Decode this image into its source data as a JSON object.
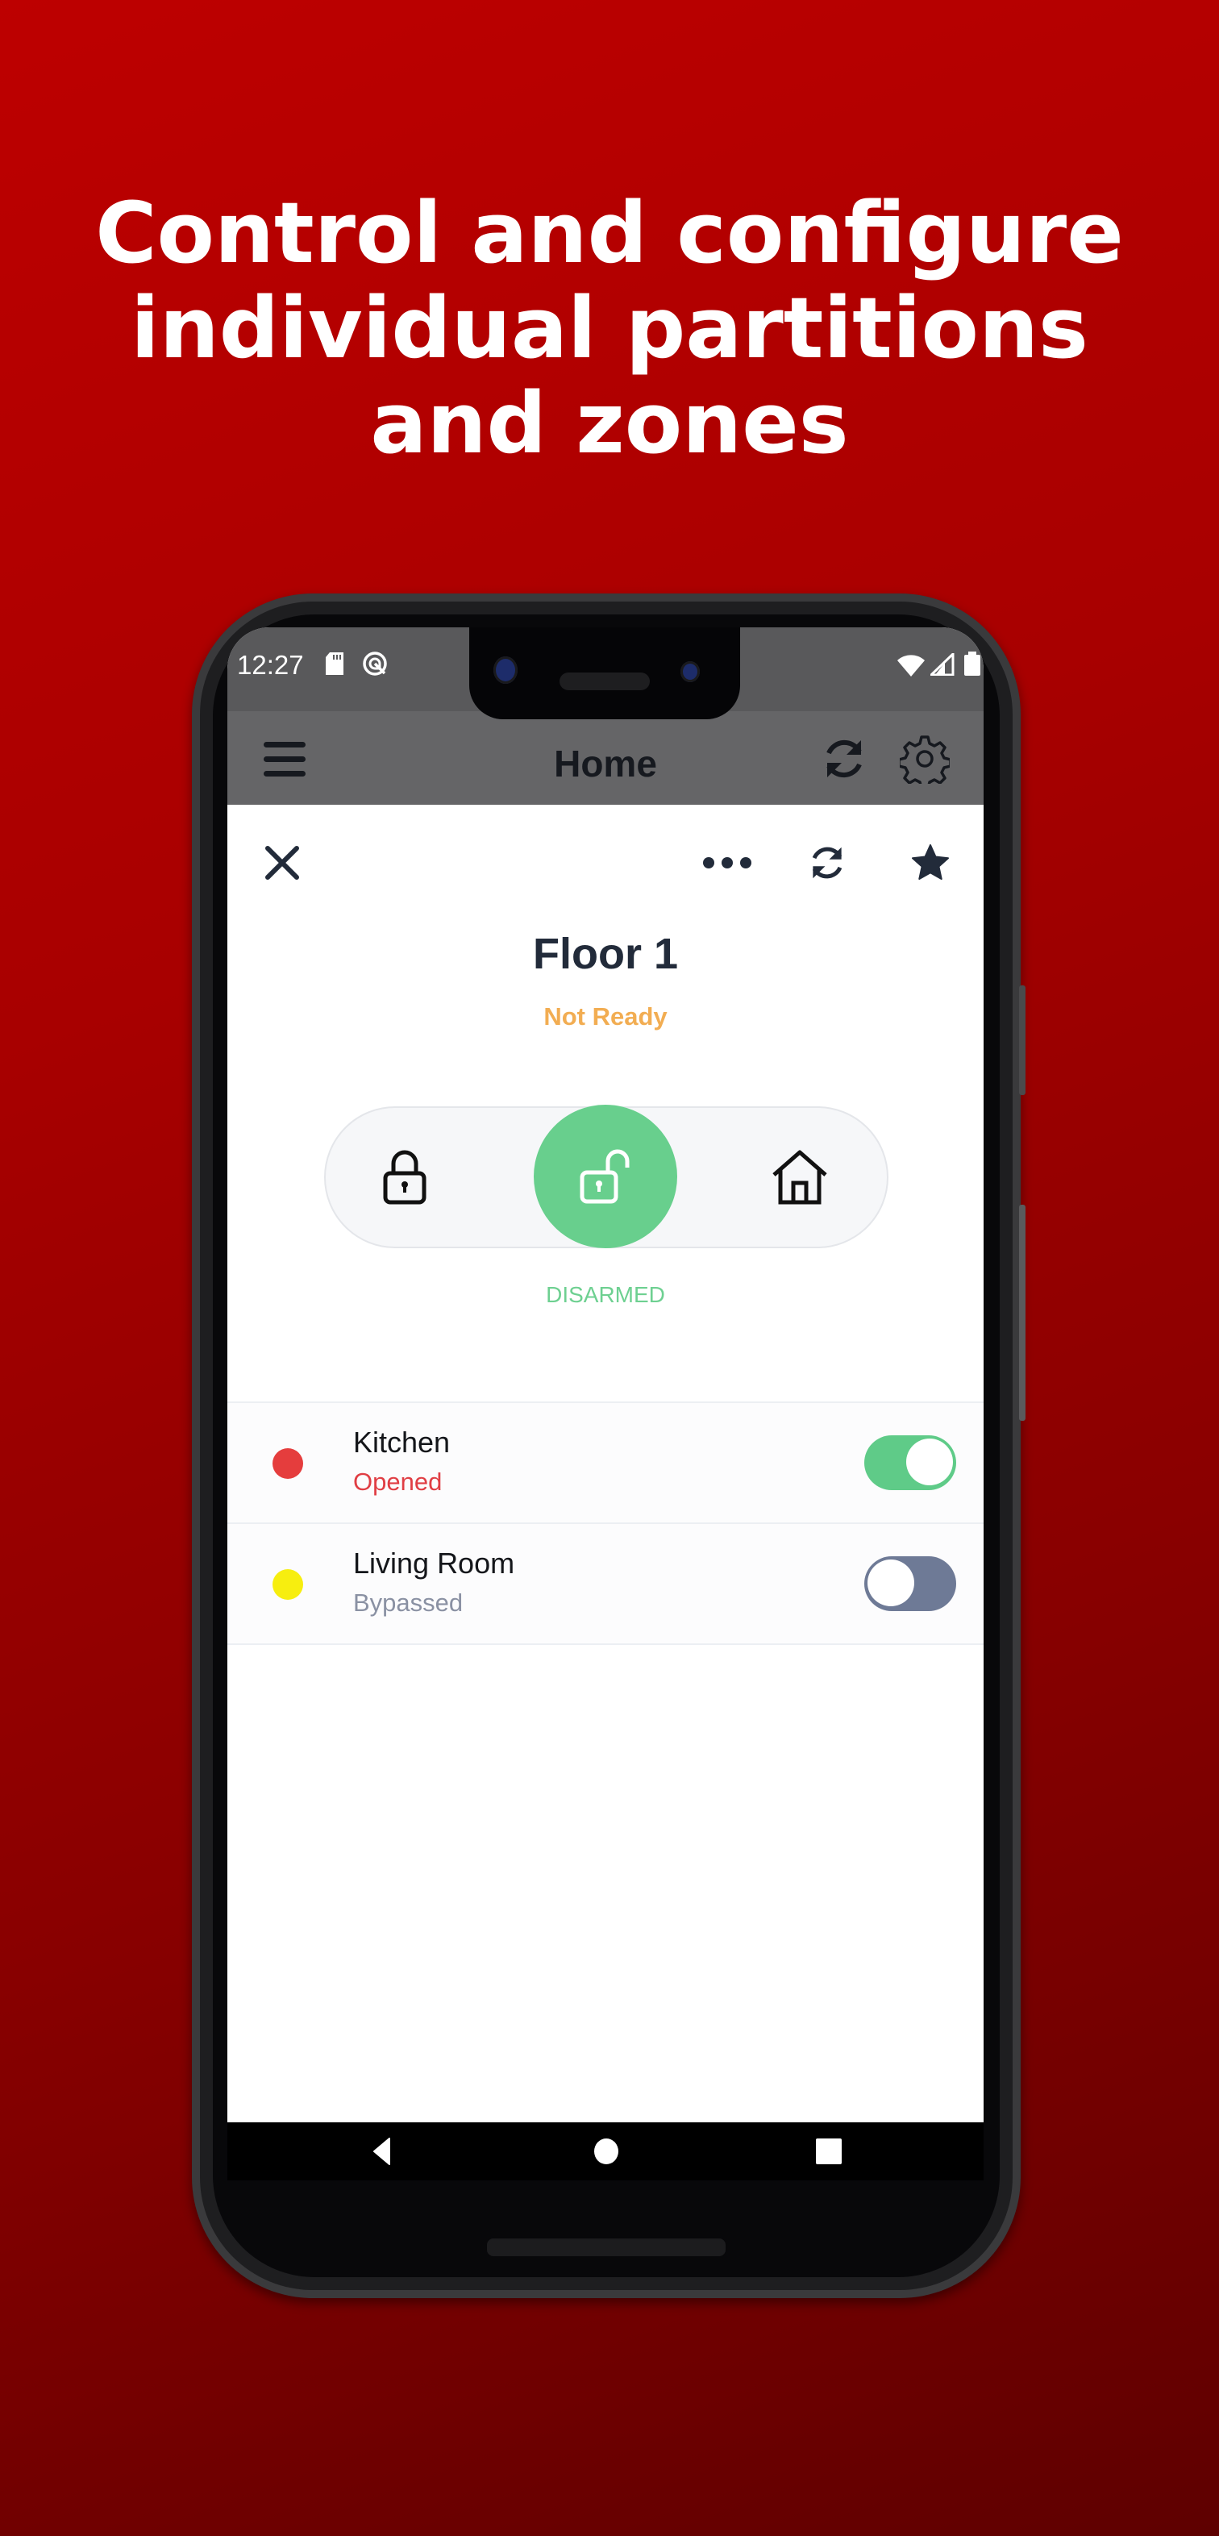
{
  "headline": {
    "lines": [
      "Control and configure",
      "individual partitions",
      "and zones"
    ]
  },
  "status_bar": {
    "time": "12:27",
    "left_icons": [
      "sd-card-icon",
      "android-q-icon"
    ],
    "right_icons": [
      "wifi-icon",
      "cellular-signal-icon",
      "battery-icon"
    ]
  },
  "app_bar": {
    "title": "Home",
    "left_icon": "menu-icon",
    "right_icons": [
      "refresh-icon",
      "settings-gear-icon"
    ]
  },
  "partition_sheet": {
    "toolbar": {
      "close_icon": "close-icon",
      "more_icon": "more-horizontal-icon",
      "refresh_icon": "refresh-icon",
      "favorite_icon": "star-icon"
    },
    "title": "Floor 1",
    "status": "Not Ready",
    "arm_modes": [
      {
        "name": "Armed Away",
        "icon": "lock-closed-icon",
        "selected": false
      },
      {
        "name": "Disarmed",
        "icon": "lock-open-icon",
        "selected": true
      },
      {
        "name": "Armed Stay",
        "icon": "home-icon",
        "selected": false
      }
    ],
    "arm_state_label": "DISARMED",
    "zones": [
      {
        "name": "Kitchen",
        "state": "Opened",
        "dot_color": "#e53d3d",
        "state_color": "#e03e44",
        "enabled": true
      },
      {
        "name": "Living Room",
        "state": "Bypassed",
        "dot_color": "#f7ee0f",
        "state_color": "#8a91a3",
        "enabled": false
      }
    ]
  },
  "nav_bar": {
    "buttons": [
      "back-icon",
      "home-circle-icon",
      "recents-square-icon"
    ]
  },
  "colors": {
    "background_top": "#bd0000",
    "background_bottom": "#5e0000",
    "status_warning": "#f2ad52",
    "disarmed_green": "#68cf8d",
    "toggle_on": "#5fcb88",
    "toggle_off": "#6e7a96",
    "title_dark": "#222b3a"
  }
}
